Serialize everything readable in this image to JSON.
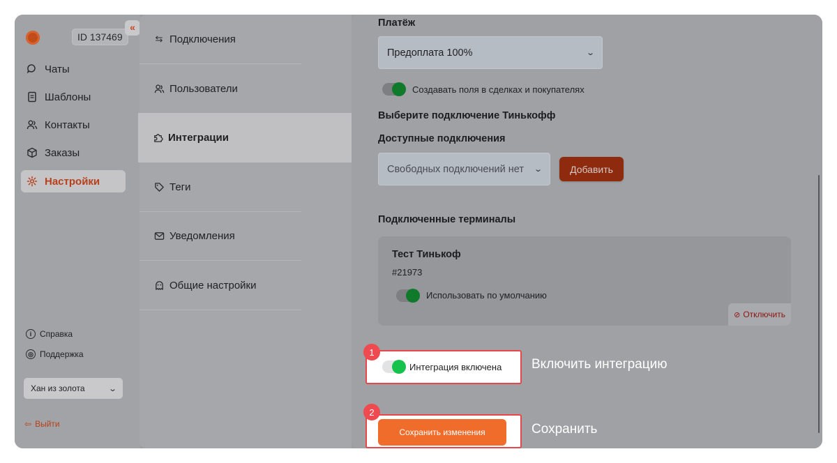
{
  "account": {
    "id_label": "ID 137469",
    "collapse_glyph": "«",
    "logo_color": "#c24b1a"
  },
  "nav": {
    "items": [
      {
        "label": "Чаты",
        "icon": "chat-icon"
      },
      {
        "label": "Шаблоны",
        "icon": "template-icon"
      },
      {
        "label": "Контакты",
        "icon": "contacts-icon"
      },
      {
        "label": "Заказы",
        "icon": "box-icon"
      },
      {
        "label": "Настройки",
        "icon": "gear-icon",
        "active": true
      }
    ],
    "help_label": "Справка",
    "support_label": "Поддержка",
    "org_selected": "Хан из золота",
    "logout_label": "Выйти"
  },
  "settings_menu": {
    "items": [
      {
        "label": "Подключения",
        "icon": "arrows-icon"
      },
      {
        "label": "Пользователи",
        "icon": "users-icon"
      },
      {
        "label": "Интеграции",
        "icon": "puzzle-icon",
        "active": true
      },
      {
        "label": "Теги",
        "icon": "tag-icon"
      },
      {
        "label": "Уведомления",
        "icon": "mail-icon"
      },
      {
        "label": "Общие настройки",
        "icon": "ghost-icon"
      }
    ]
  },
  "content": {
    "payment_label": "Платёж",
    "payment_value": "Предоплата 100%",
    "create_fields_label": "Создавать поля в сделках и покупателях",
    "choose_connection_label": "Выберите подключение Тинькофф",
    "available_label": "Доступные подключения",
    "available_value": "Свободных подключений нет",
    "add_button": "Добавить",
    "connected_terminals_label": "Подключенные терминалы",
    "terminal": {
      "name": "Тест Тинькоф",
      "number": "#21973",
      "default_label": "Использовать по умолчанию",
      "disconnect_label": "Отключить"
    },
    "integration_label": "Интеграция включена",
    "save_button": "Сохранить изменения"
  },
  "callouts": [
    {
      "badge": "1",
      "text": "Включить интеграцию"
    },
    {
      "badge": "2",
      "text": "Сохранить"
    }
  ],
  "colors": {
    "accent": "#ef6c2b",
    "highlight": "#e8464a",
    "toggle_on": "#14c24c",
    "danger": "#8e1414"
  }
}
